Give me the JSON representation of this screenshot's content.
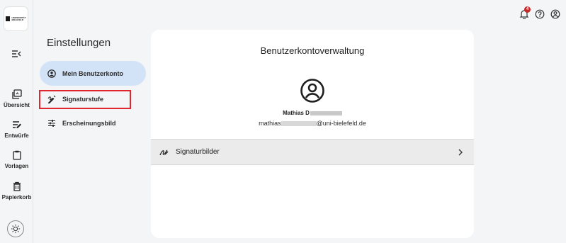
{
  "logo": {
    "text": "UNIVERSITÄT BIELEFELD",
    "block_color": "#1a1a1a"
  },
  "rail": {
    "menu_icon": "menu-collapse-icon",
    "items": [
      {
        "label": "Übersicht",
        "icon": "library-icon"
      },
      {
        "label": "Entwürfe",
        "icon": "draft-edit-icon"
      },
      {
        "label": "Vorlagen",
        "icon": "clipboard-icon"
      },
      {
        "label": "Papierkorb",
        "icon": "trash-icon"
      }
    ],
    "theme_icon": "brightness-icon"
  },
  "header": {
    "notifications_count": "4",
    "notification_icon": "bell-icon",
    "help_icon": "help-icon",
    "account_icon": "account-icon"
  },
  "settings": {
    "title": "Einstellungen",
    "items": [
      {
        "label": "Mein Benutzerkonto",
        "icon": "account-circle-icon",
        "active": true
      },
      {
        "label": "Signaturstufe",
        "icon": "signature-level-icon",
        "active": false
      },
      {
        "label": "Erscheinungsbild",
        "icon": "tune-icon",
        "active": false
      }
    ]
  },
  "account": {
    "title": "Benutzerkontoverwaltung",
    "name": "Mathias D",
    "email_prefix": "mathias",
    "email_suffix": "@uni-bielefeld.de",
    "rows": [
      {
        "label": "Signaturbilder",
        "icon": "signature-icon"
      }
    ]
  },
  "colors": {
    "accent_active": "#d3e3f7",
    "highlight_border": "#e0262e",
    "badge": "#c62828"
  }
}
